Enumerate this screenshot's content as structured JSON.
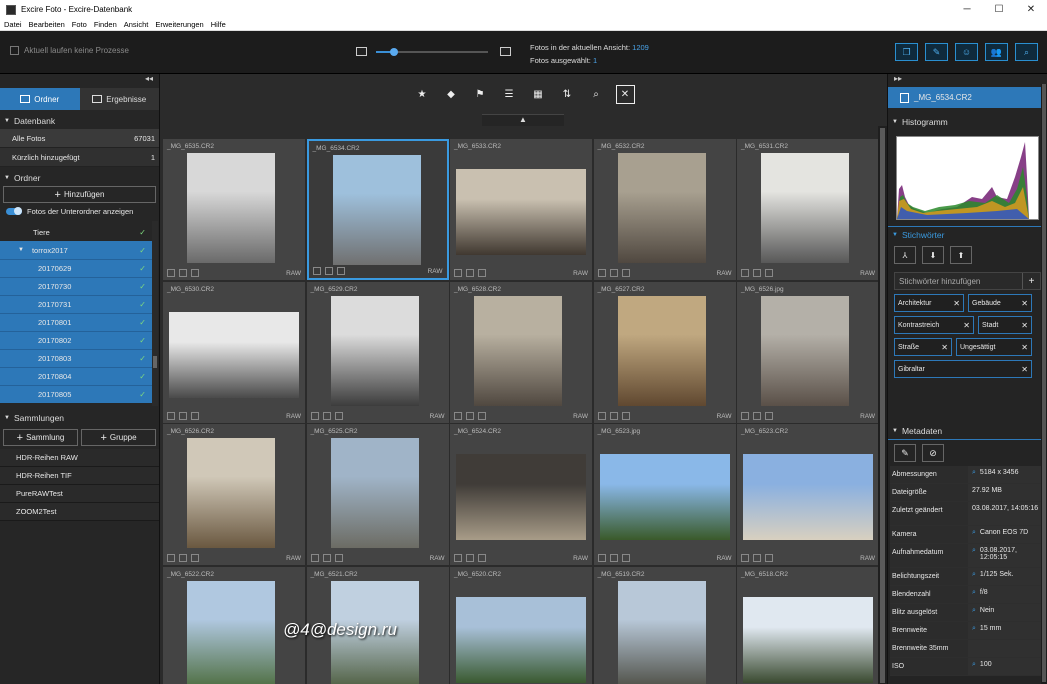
{
  "window": {
    "title": "Excire Foto - Excire-Datenbank"
  },
  "menu": [
    "Datei",
    "Bearbeiten",
    "Foto",
    "Finden",
    "Ansicht",
    "Erweiterungen",
    "Hilfe"
  ],
  "toolbar": {
    "process_status": "Aktuell laufen keine Prozesse",
    "zoom_value": 0.16,
    "photos_in_view_label": "Fotos in der aktuellen Ansicht:",
    "photos_in_view": "1209",
    "photos_selected_label": "Fotos ausgewählt:",
    "photos_selected": "1",
    "accent": "#2d78b8"
  },
  "left": {
    "collapse": "◂◂",
    "tabs": [
      {
        "label": "Ordner"
      },
      {
        "label": "Ergebnisse"
      }
    ],
    "database": {
      "title": "Datenbank",
      "rows": [
        {
          "label": "Alle Fotos",
          "count": "67031"
        },
        {
          "label": "Kürzlich hinzugefügt",
          "count": "1"
        }
      ]
    },
    "folders": {
      "title": "Ordner",
      "add": "Hinzufügen",
      "show_sub": "Fotos der Unterordner anzeigen",
      "tree": [
        {
          "label": "Tiere",
          "check": "✓"
        },
        {
          "label": "torrox2017",
          "check": "✓"
        },
        {
          "label": "20170629",
          "check": "✓"
        },
        {
          "label": "20170730",
          "check": "✓"
        },
        {
          "label": "20170731",
          "check": "✓"
        },
        {
          "label": "20170801",
          "check": "✓"
        },
        {
          "label": "20170802",
          "check": "✓"
        },
        {
          "label": "20170803",
          "check": "✓"
        },
        {
          "label": "20170804",
          "check": "✓"
        },
        {
          "label": "20170805",
          "check": "✓"
        }
      ]
    },
    "collections": {
      "title": "Sammlungen",
      "add_collection": "Sammlung",
      "add_group": "Gruppe",
      "items": [
        "HDR-Reihen RAW",
        "HDR-Reihen TIF",
        "PureRAWTest",
        "ZOOM2Test"
      ]
    }
  },
  "grid": {
    "photos": [
      {
        "name": "_MG_6535.CR2",
        "tag": "RAW"
      },
      {
        "name": "_MG_6534.CR2",
        "tag": "RAW"
      },
      {
        "name": "_MG_6533.CR2",
        "tag": "RAW"
      },
      {
        "name": "_MG_6532.CR2",
        "tag": "RAW"
      },
      {
        "name": "_MG_6531.CR2",
        "tag": "RAW"
      },
      {
        "name": "_MG_6530.CR2",
        "tag": "RAW"
      },
      {
        "name": "_MG_6529.CR2",
        "tag": "RAW"
      },
      {
        "name": "_MG_6528.CR2",
        "tag": "RAW"
      },
      {
        "name": "_MG_6527.CR2",
        "tag": "RAW"
      },
      {
        "name": "_MG_6526.jpg",
        "tag": "RAW"
      },
      {
        "name": "_MG_6526.CR2",
        "tag": "RAW"
      },
      {
        "name": "_MG_6525.CR2",
        "tag": "RAW"
      },
      {
        "name": "_MG_6524.CR2",
        "tag": "RAW"
      },
      {
        "name": "_MG_6523.jpg",
        "tag": "RAW"
      },
      {
        "name": "_MG_6523.CR2",
        "tag": "RAW"
      },
      {
        "name": "_MG_6522.CR2",
        "tag": ""
      },
      {
        "name": "_MG_6521.CR2",
        "tag": ""
      },
      {
        "name": "_MG_6520.CR2",
        "tag": ""
      },
      {
        "name": "_MG_6519.CR2",
        "tag": ""
      },
      {
        "name": "_MG_6518.CR2",
        "tag": ""
      }
    ],
    "watermark": "@4@design.ru"
  },
  "right": {
    "collapse": "▸▸",
    "selected_file": "_MG_6534.CR2",
    "histogram_title": "Histogramm",
    "keywords_title": "Stichwörter",
    "keyword_placeholder": "Stichwörter hinzufügen",
    "keywords": [
      "Architektur",
      "Gebäude",
      "Kontrastreich",
      "Stadt",
      "Straße",
      "Ungesättigt",
      "Gibraltar"
    ],
    "metadata_title": "Metadaten",
    "metadata": [
      {
        "k": "Abmessungen",
        "v": "5184 x 3456",
        "q": true
      },
      {
        "k": "Dateigröße",
        "v": "27.92 MB",
        "q": false
      },
      {
        "k": "Zuletzt geändert",
        "v": "03.08.2017, 14:05:16",
        "q": false
      },
      {
        "k": "Kamera",
        "v": "Canon EOS 7D",
        "q": true
      },
      {
        "k": "Aufnahmedatum",
        "v": "03.08.2017, 12:05:15",
        "q": true
      },
      {
        "k": "Belichtungszeit",
        "v": "1/125 Sek.",
        "q": true
      },
      {
        "k": "Blendenzahl",
        "v": "f/8",
        "q": true
      },
      {
        "k": "Blitz ausgelöst",
        "v": "Nein",
        "q": true
      },
      {
        "k": "Brennweite",
        "v": "15 mm",
        "q": true
      },
      {
        "k": "Brennweite 35mm",
        "v": "",
        "q": false
      },
      {
        "k": "ISO",
        "v": "100",
        "q": true
      }
    ]
  }
}
